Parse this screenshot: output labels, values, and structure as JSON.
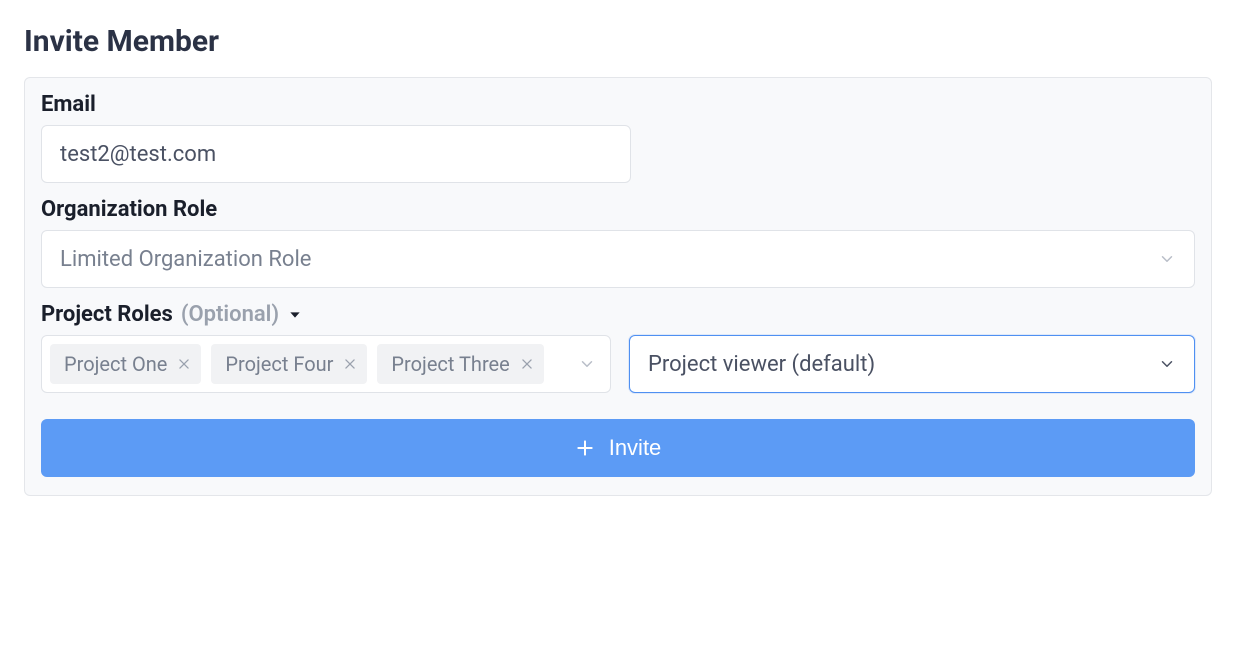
{
  "title": "Invite Member",
  "email": {
    "label": "Email",
    "value": "test2@test.com"
  },
  "org_role": {
    "label": "Organization Role",
    "selected": "Limited Organization Role"
  },
  "project_roles": {
    "label": "Project Roles",
    "optional": "(Optional)",
    "chips": [
      "Project One",
      "Project Four",
      "Project Three"
    ],
    "role_selected": "Project viewer (default)"
  },
  "invite_button": "Invite"
}
